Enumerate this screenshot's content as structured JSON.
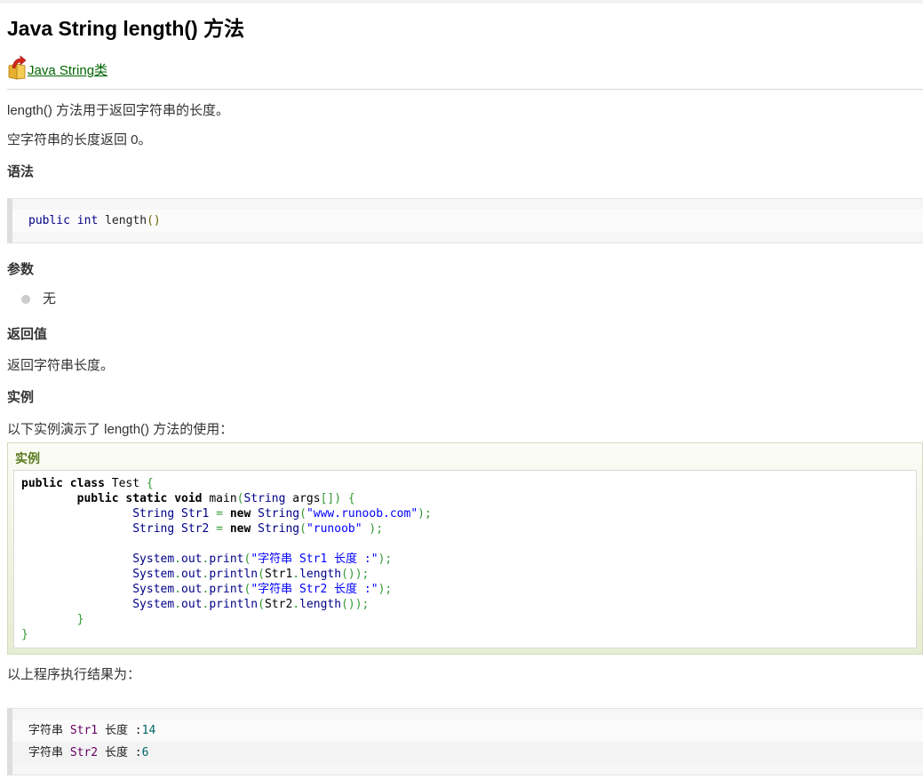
{
  "page": {
    "title": "Java String length() 方法",
    "back_link": "Java String类",
    "intro": [
      "length() 方法用于返回字符串的长度。",
      "空字符串的长度返回 0。"
    ]
  },
  "syntax": {
    "heading": "语法",
    "code": "public int length()"
  },
  "params": {
    "heading": "参数",
    "items": [
      "无"
    ]
  },
  "returns": {
    "heading": "返回值",
    "text": "返回字符串长度。"
  },
  "example": {
    "heading": "实例",
    "intro": "以下实例演示了 length() 方法的使用：",
    "box_title": "实例",
    "code_lines": [
      "public class Test {",
      "        public static void main(String args[]) {",
      "                String Str1 = new String(\"www.runoob.com\");",
      "                String Str2 = new String(\"runoob\" );",
      "",
      "                System.out.print(\"字符串 Str1 长度 :\");",
      "                System.out.println(Str1.length());",
      "                System.out.print(\"字符串 Str2 长度 :\");",
      "                System.out.println(Str2.length());",
      "        }",
      "}"
    ]
  },
  "result": {
    "intro": "以上程序执行结果为：",
    "lines": [
      {
        "pre": "字符串 ",
        "kw": "Str1",
        "mid": " 长度 :",
        "num": "14"
      },
      {
        "pre": "字符串 ",
        "kw": "Str2",
        "mid": " 长度 :",
        "num": "6"
      }
    ]
  }
}
